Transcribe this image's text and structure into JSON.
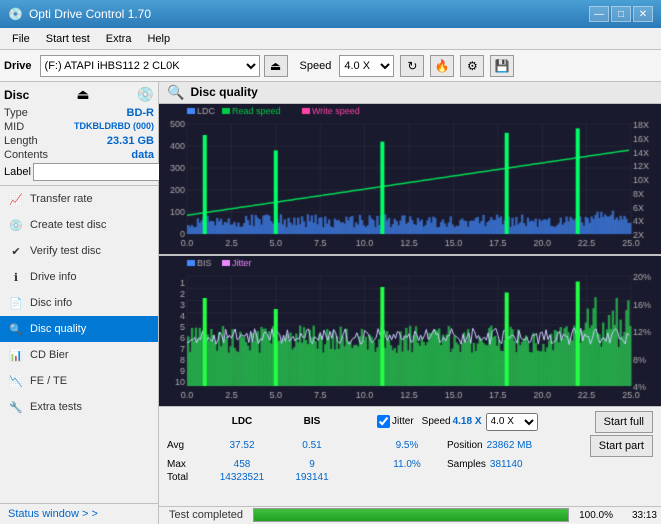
{
  "titleBar": {
    "title": "Opti Drive Control 1.70",
    "icon": "💿",
    "controls": [
      "—",
      "□",
      "✕"
    ]
  },
  "menuBar": {
    "items": [
      "File",
      "Start test",
      "Extra",
      "Help"
    ]
  },
  "toolbar": {
    "driveLabel": "Drive",
    "driveValue": "(F:)  ATAPI iHBS112  2 CL0K",
    "speedLabel": "Speed",
    "speedValue": "4.0 X"
  },
  "disc": {
    "title": "Disc",
    "fields": [
      {
        "label": "Type",
        "value": "BD-R"
      },
      {
        "label": "MID",
        "value": "TDKBLDRBD (000)"
      },
      {
        "label": "Length",
        "value": "23.31 GB"
      },
      {
        "label": "Contents",
        "value": "data"
      },
      {
        "label": "Label",
        "value": ""
      }
    ]
  },
  "nav": {
    "items": [
      {
        "label": "Transfer rate",
        "icon": "📈",
        "active": false
      },
      {
        "label": "Create test disc",
        "icon": "💿",
        "active": false
      },
      {
        "label": "Verify test disc",
        "icon": "✔",
        "active": false
      },
      {
        "label": "Drive info",
        "icon": "ℹ",
        "active": false
      },
      {
        "label": "Disc info",
        "icon": "📄",
        "active": false
      },
      {
        "label": "Disc quality",
        "icon": "🔍",
        "active": true
      },
      {
        "label": "CD Bier",
        "icon": "📊",
        "active": false
      },
      {
        "label": "FE / TE",
        "icon": "📉",
        "active": false
      },
      {
        "label": "Extra tests",
        "icon": "🔧",
        "active": false
      }
    ]
  },
  "statusWindow": {
    "label": "Status window > >"
  },
  "discQuality": {
    "title": "Disc quality",
    "legend": {
      "ldc": "LDC",
      "readSpeed": "Read speed",
      "writeSpeed": "Write speed",
      "bis": "BIS",
      "jitter": "Jitter"
    }
  },
  "stats": {
    "headers": [
      "LDC",
      "BIS",
      "",
      "Jitter",
      "Speed",
      ""
    ],
    "rows": [
      {
        "label": "Avg",
        "ldc": "37.52",
        "bis": "0.51",
        "jitter": "9.5%",
        "speed": "4.18 X",
        "speedTarget": "4.0 X"
      },
      {
        "label": "Max",
        "ldc": "458",
        "bis": "9",
        "jitter": "11.0%",
        "position": "Position",
        "posVal": "23862 MB"
      },
      {
        "label": "Total",
        "ldc": "14323521",
        "bis": "193141",
        "jitter": "",
        "samples": "Samples",
        "samplesVal": "381140"
      }
    ],
    "jitterChecked": true,
    "speedVal": "4.18 X",
    "speedTarget": "4.0 X",
    "positionLabel": "Position",
    "positionVal": "23862 MB",
    "samplesLabel": "Samples",
    "samplesVal": "381140"
  },
  "buttons": {
    "startFull": "Start full",
    "startPart": "Start part"
  },
  "progress": {
    "percent": "100.0%",
    "time": "33:13",
    "statusText": "Test completed"
  },
  "charts": {
    "top": {
      "yMax": 500,
      "yLabels": [
        "500",
        "400",
        "300",
        "200",
        "100",
        "0"
      ],
      "yRight": [
        "18X",
        "16X",
        "14X",
        "12X",
        "10X",
        "8X",
        "6X",
        "4X",
        "2X"
      ],
      "xMax": 25.0
    },
    "bottom": {
      "yMax": 10,
      "yLabels": [
        "10",
        "9",
        "8",
        "7",
        "6",
        "5",
        "4",
        "3",
        "2",
        "1"
      ],
      "yRight": [
        "20%",
        "16%",
        "12%",
        "8%",
        "4%"
      ],
      "xMax": 25.0
    }
  }
}
